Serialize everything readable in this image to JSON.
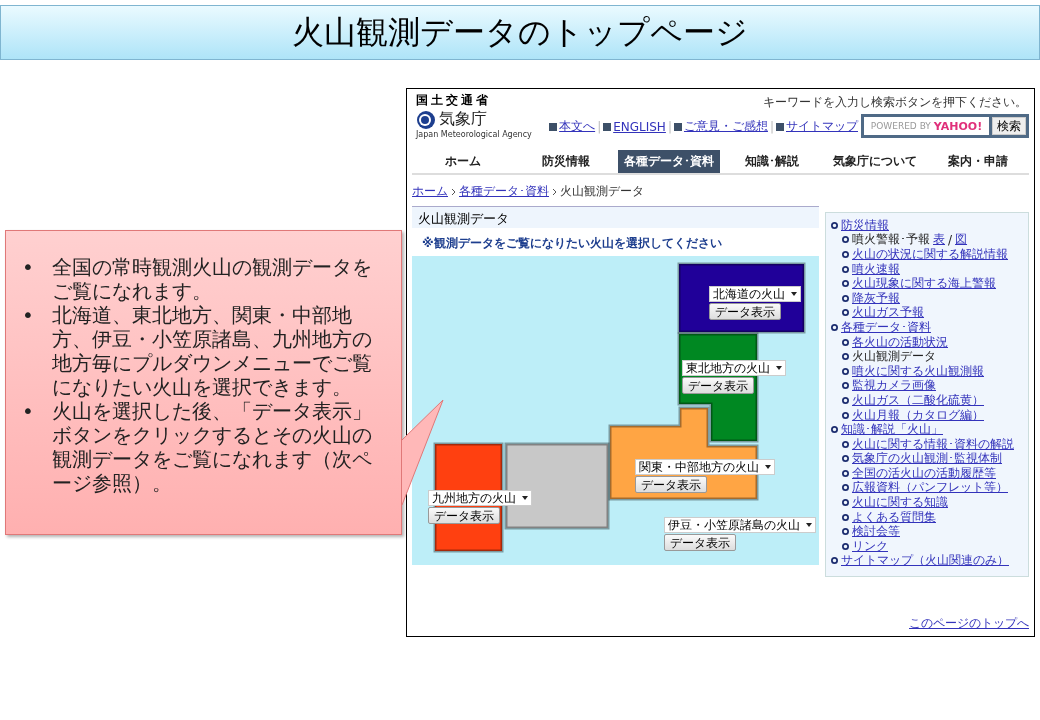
{
  "slide_title": "火山観測データのトップページ",
  "callout": {
    "bullet": "•",
    "bullets": [
      "全国の常時観測火山の観測データをご覧になれます。",
      "北海道、東北地方、関東・中部地方、伊豆・小笠原諸島、九州地方の地方毎にプルダウンメニューでご覧になりたい火山を選択できます。",
      "火山を選択した後、「データ表示」ボタンをクリックするとその火山の観測データをご覧になれます（次ページ参照）。"
    ]
  },
  "site": {
    "ministry": "国土交通省",
    "agency": "気象庁",
    "agency_en": "Japan Meteorological Agency",
    "header_links": [
      "本文へ",
      "ENGLISH",
      "ご意見・ご感想",
      "サイトマップ"
    ],
    "link_separator": "|",
    "search": {
      "caption": "キーワードを入力し検索ボタンを押下ください。",
      "powered_by": "POWERED BY",
      "provider": "YAHOO!",
      "button": "検索"
    },
    "nav": [
      {
        "label": "ホーム",
        "selected": false
      },
      {
        "label": "防災情報",
        "selected": false
      },
      {
        "label": "各種データ･資料",
        "selected": true
      },
      {
        "label": "知識･解説",
        "selected": false
      },
      {
        "label": "気象庁について",
        "selected": false
      },
      {
        "label": "案内・申請",
        "selected": false
      }
    ],
    "breadcrumb": [
      {
        "label": "ホーム",
        "link": true
      },
      {
        "label": "各種データ･資料",
        "link": true
      },
      {
        "label": "火山観測データ",
        "link": false
      }
    ],
    "heading": "火山観測データ",
    "instruction": "※観測データをご覧になりたい火山を選択してください",
    "regions": [
      {
        "color": "#200099",
        "select": "北海道の火山",
        "button": "データ表示"
      },
      {
        "color": "#008822",
        "select": "東北地方の火山",
        "button": "データ表示"
      },
      {
        "color": "#ffa544",
        "select": "関東・中部地方の火山",
        "button": "データ表示"
      },
      {
        "color": "#c8c8c8"
      },
      {
        "color": "#ff4010",
        "select": "九州地方の火山",
        "button": "データ表示"
      },
      {
        "select": "伊豆・小笠原諸島の火山",
        "button": "データ表示"
      }
    ],
    "sidebar": [
      {
        "label": "防災情報",
        "link": true,
        "children": [
          {
            "label": "噴火警報･予報",
            "link": false,
            "links": [
              "表",
              "図"
            ],
            "separator": "/"
          },
          {
            "label": "火山の状況に関する解説情報",
            "link": true
          },
          {
            "label": "噴火速報",
            "link": true
          },
          {
            "label": "火山現象に関する海上警報",
            "link": true
          },
          {
            "label": "降灰予報",
            "link": true
          },
          {
            "label": "火山ガス予報",
            "link": true
          }
        ]
      },
      {
        "label": "各種データ･資料",
        "link": true,
        "children": [
          {
            "label": "各火山の活動状況",
            "link": true
          },
          {
            "label": "火山観測データ",
            "link": false
          },
          {
            "label": "噴火に関する火山観測報",
            "link": true
          },
          {
            "label": "監視カメラ画像",
            "link": true
          },
          {
            "label": "火山ガス（二酸化硫黄）",
            "link": true
          },
          {
            "label": "火山月報（カタログ編）",
            "link": true
          }
        ]
      },
      {
        "label": "知識･解説「火山」",
        "link": true,
        "children": [
          {
            "label": "火山に関する情報･資料の解説",
            "link": true
          },
          {
            "label": "気象庁の火山観測･監視体制",
            "link": true
          },
          {
            "label": "全国の活火山の活動履歴等",
            "link": true
          },
          {
            "label": "広報資料（パンフレット等）",
            "link": true
          },
          {
            "label": "火山に関する知識",
            "link": true
          },
          {
            "label": "よくある質問集",
            "link": true
          },
          {
            "label": "検討会等",
            "link": true
          },
          {
            "label": "リンク",
            "link": true
          }
        ]
      },
      {
        "label": "サイトマップ（火山関連のみ）",
        "link": true
      }
    ],
    "page_top": "このページのトップへ"
  }
}
